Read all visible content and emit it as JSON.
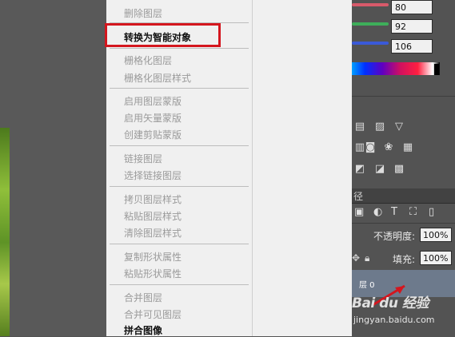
{
  "color_panel": {
    "r_value": "80",
    "g_value": "92",
    "b_value": "106",
    "slider_colors": [
      "#d85a6a",
      "#3eae5a",
      "#3a5ad8"
    ]
  },
  "layers_panel": {
    "tab_label": "径",
    "opacity_label": "不透明度:",
    "opacity_value": "100%",
    "fill_label": "填充:",
    "fill_value": "100%",
    "layer_name": "层 0",
    "filter_icons": [
      "image-icon",
      "adjust-icon",
      "text-icon",
      "shape-icon",
      "smart-object-icon"
    ]
  },
  "context_menu": {
    "items": [
      {
        "label": "删除图层",
        "enabled": false
      },
      {
        "label": "转换为智能对象",
        "enabled": true,
        "highlighted": true
      },
      {
        "label": "栅格化图层",
        "enabled": false
      },
      {
        "label": "栅格化图层样式",
        "enabled": false
      },
      {
        "label": "启用图层蒙版",
        "enabled": false
      },
      {
        "label": "启用矢量蒙版",
        "enabled": false
      },
      {
        "label": "创建剪贴蒙版",
        "enabled": false
      },
      {
        "label": "链接图层",
        "enabled": false
      },
      {
        "label": "选择链接图层",
        "enabled": false
      },
      {
        "label": "拷贝图层样式",
        "enabled": false
      },
      {
        "label": "粘贴图层样式",
        "enabled": false
      },
      {
        "label": "清除图层样式",
        "enabled": false
      },
      {
        "label": "复制形状属性",
        "enabled": false
      },
      {
        "label": "粘贴形状属性",
        "enabled": false
      },
      {
        "label": "合并图层",
        "enabled": false
      },
      {
        "label": "合并可见图层",
        "enabled": false
      },
      {
        "label": "拼合图像",
        "enabled": true
      }
    ]
  },
  "watermark": {
    "brand": "Bai du 经验",
    "url": "jingyan.baidu.com"
  },
  "colors": {
    "highlight_border": "#d4161e",
    "panel_bg": "#535353",
    "menu_bg": "#f0f0f0"
  }
}
